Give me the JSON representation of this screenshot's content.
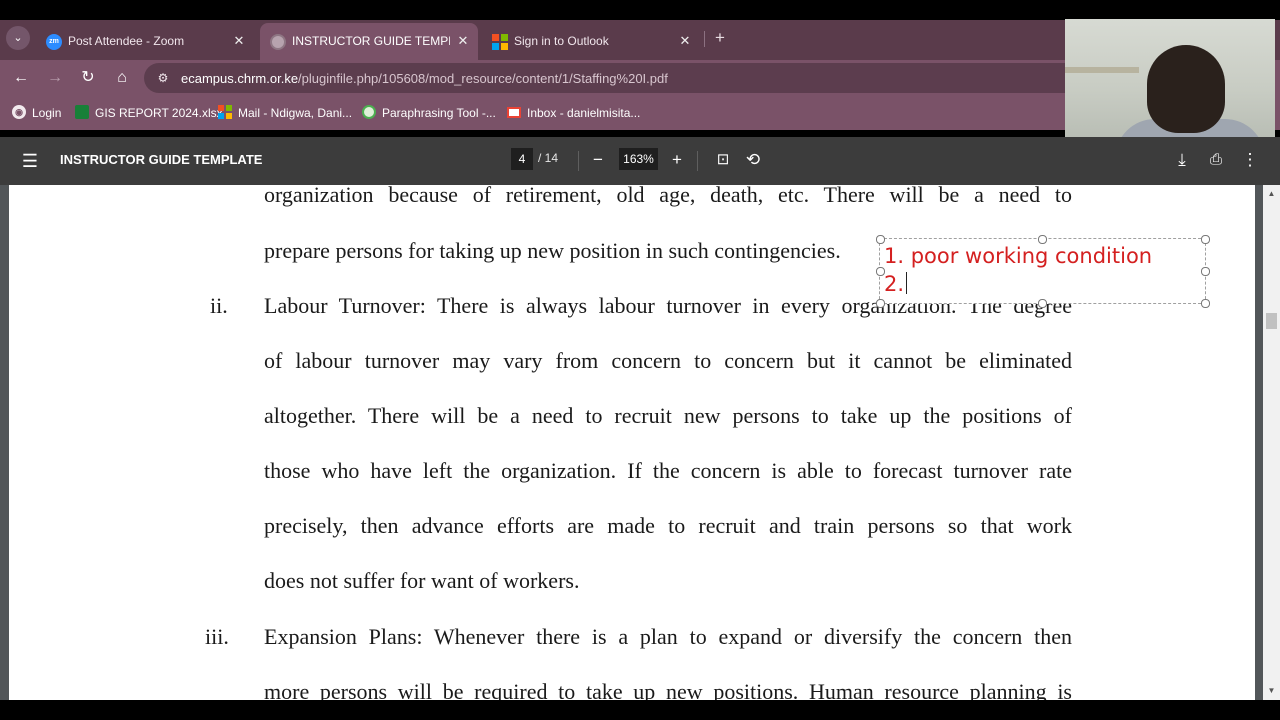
{
  "browser": {
    "tabs": [
      {
        "label": "Post Attendee - Zoom",
        "icon": "zoom-icon",
        "active": false
      },
      {
        "label": "INSTRUCTOR GUIDE TEMPLATE",
        "icon": "chrome-pdf-icon",
        "active": true
      },
      {
        "label": "Sign in to Outlook",
        "icon": "microsoft-icon",
        "active": false
      }
    ],
    "address": {
      "host": "ecampus.chrm.or.ke",
      "path": "/pluginfile.php/105608/mod_resource/content/1/Staffing%20I.pdf"
    },
    "bookmarks": [
      {
        "label": "Login",
        "icon": "globe-icon"
      },
      {
        "label": "GIS REPORT 2024.xlsx",
        "icon": "sheets-icon"
      },
      {
        "label": "Mail - Ndigwa, Dani...",
        "icon": "microsoft-icon"
      },
      {
        "label": "Paraphrasing Tool -...",
        "icon": "paraphrase-icon"
      },
      {
        "label": "Inbox - danielmisita...",
        "icon": "gmail-icon"
      }
    ]
  },
  "pdf_viewer": {
    "title": "INSTRUCTOR GUIDE TEMPLATE",
    "current_page": "4",
    "total_pages": "/ 14",
    "zoom": "163%"
  },
  "document": {
    "lines": [
      "organization because of retirement, old age, death, etc. There will be a need to",
      "prepare persons for taking up new position in such contingencies.",
      "Labour Turnover: There is always labour turnover in every organization. The degree",
      "of labour turnover may vary from concern to concern but it cannot be eliminated",
      "altogether. There will be a need to recruit new persons to take up the positions of",
      "those who have left the organization. If the concern is able to forecast turnover rate",
      "precisely, then advance efforts are made to recruit and train persons so that work",
      "does not suffer for want of workers.",
      "Expansion Plans: Whenever there is a plan to expand or diversify the concern then",
      "more persons will be required to take up new positions. Human resource planning is"
    ],
    "markers": {
      "ii": "ii.",
      "iii": "iii."
    }
  },
  "annotation": {
    "line1": "1. poor working condition",
    "line2": "2."
  },
  "colors": {
    "tab_strip": "#5a3b4b",
    "toolbar": "#7a5268",
    "pdf_toolbar": "#3c3c3c",
    "annotation_text": "#d42020"
  }
}
